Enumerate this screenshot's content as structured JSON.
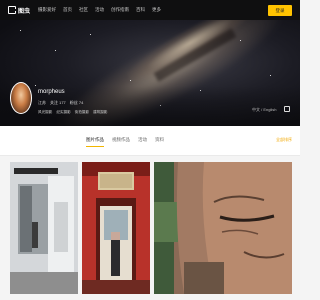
{
  "topbar": {
    "logo_text": "图虫",
    "nav": [
      "摄影爱好",
      "首页",
      "社区",
      "活动",
      "创作指南",
      "百科",
      "更多"
    ],
    "login_label": "登录"
  },
  "profile": {
    "username": "morpheus",
    "stats": [
      "江苏",
      "关注 177",
      "粉丝 74"
    ],
    "tags": [
      "风光摄影",
      "纪实摄影",
      "街拍摄影",
      "建筑摄影"
    ],
    "language": "中文 / English"
  },
  "tabs": {
    "items": [
      "图片作品",
      "视频作品",
      "活动",
      "资料"
    ],
    "active_index": 0,
    "sort_label": "全部排序"
  },
  "photos": [
    {
      "name": "street-building-door-photo"
    },
    {
      "name": "red-temple-gate-photo"
    },
    {
      "name": "stone-buddha-face-photo"
    }
  ],
  "colors": {
    "topbar_bg": "#0f0f10",
    "accent": "#ffc300"
  }
}
